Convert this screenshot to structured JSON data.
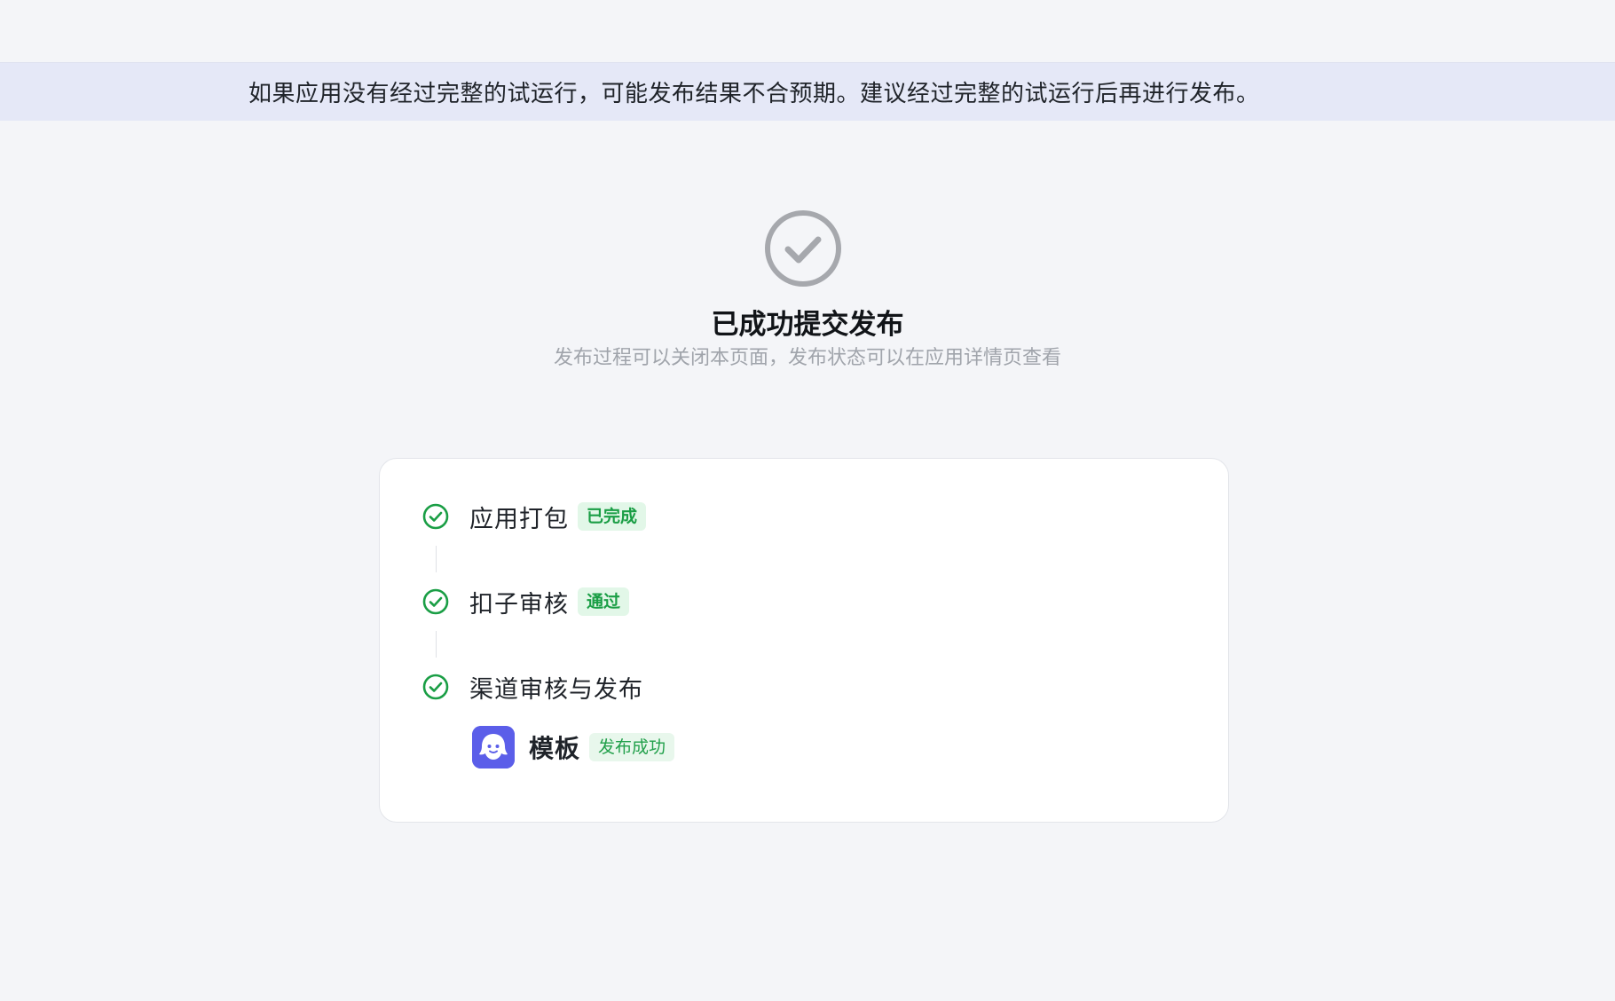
{
  "notice": {
    "text": "如果应用没有经过完整的试运行，可能发布结果不合预期。建议经过完整的试运行后再进行发布。"
  },
  "result": {
    "icon": "check-circle-icon",
    "title": "已成功提交发布",
    "subtitle": "发布过程可以关闭本页面，发布状态可以在应用详情页查看"
  },
  "steps": [
    {
      "label": "应用打包",
      "status": "已完成",
      "icon": "check-circle-icon"
    },
    {
      "label": "扣子审核",
      "status": "通过",
      "icon": "check-circle-icon"
    },
    {
      "label": "渠道审核与发布",
      "icon": "check-circle-icon"
    }
  ],
  "channels": [
    {
      "name": "模板",
      "status": "发布成功",
      "icon": "coze-logo-icon"
    }
  ],
  "colors": {
    "success": "#1a9e45",
    "notice_bg": "#e5e8f7",
    "page_bg": "#f4f5f8",
    "brand": "#5b5ee9"
  }
}
